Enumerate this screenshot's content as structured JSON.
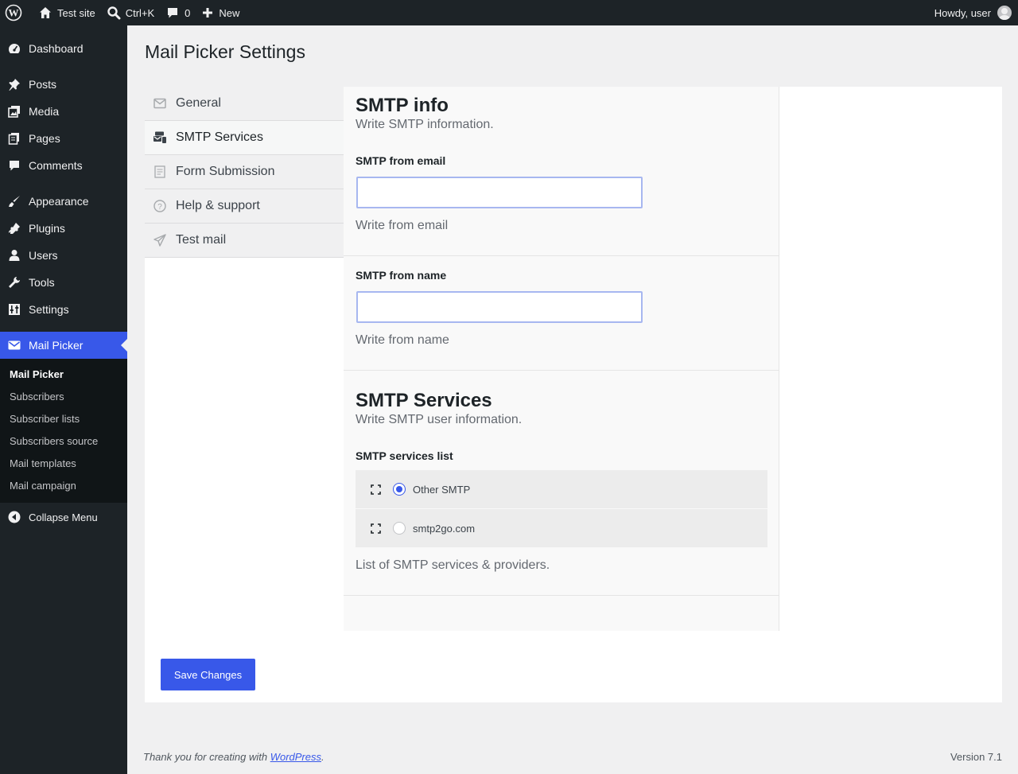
{
  "adminbar": {
    "site_name": "Test site",
    "search_shortcut": "Ctrl+K",
    "comments_count": "0",
    "new_label": "New",
    "greeting": "Howdy, user"
  },
  "sidebar": {
    "items": [
      {
        "label": "Dashboard",
        "icon": "dashboard-icon"
      },
      {
        "label": "Posts",
        "icon": "pin-icon"
      },
      {
        "label": "Media",
        "icon": "media-icon"
      },
      {
        "label": "Pages",
        "icon": "pages-icon"
      },
      {
        "label": "Comments",
        "icon": "comment-icon"
      },
      {
        "label": "Appearance",
        "icon": "brush-icon"
      },
      {
        "label": "Plugins",
        "icon": "plugin-icon"
      },
      {
        "label": "Users",
        "icon": "user-icon"
      },
      {
        "label": "Tools",
        "icon": "wrench-icon"
      },
      {
        "label": "Settings",
        "icon": "sliders-icon"
      },
      {
        "label": "Mail Picker",
        "icon": "envelope-icon"
      }
    ],
    "submenu": [
      "Mail Picker",
      "Subscribers",
      "Subscriber lists",
      "Subscribers source",
      "Mail templates",
      "Mail campaign"
    ],
    "collapse_label": "Collapse Menu",
    "accent": "#3858e9"
  },
  "page": {
    "title": "Mail Picker Settings"
  },
  "tabs": [
    {
      "label": "General",
      "icon": "envelope-outline-icon"
    },
    {
      "label": "SMTP Services",
      "icon": "mail-server-icon"
    },
    {
      "label": "Form Submission",
      "icon": "form-icon"
    },
    {
      "label": "Help & support",
      "icon": "question-icon"
    },
    {
      "label": "Test mail",
      "icon": "paper-plane-icon"
    }
  ],
  "smtp_info": {
    "title": "SMTP info",
    "description": "Write SMTP information.",
    "from_email": {
      "label": "SMTP from email",
      "value": "",
      "help": "Write from email"
    },
    "from_name": {
      "label": "SMTP from name",
      "value": "",
      "help": "Write from name"
    }
  },
  "smtp_services": {
    "title": "SMTP Services",
    "description": "Write SMTP user information.",
    "list_label": "SMTP services list",
    "options": [
      {
        "label": "Other SMTP",
        "checked": true
      },
      {
        "label": "smtp2go.com",
        "checked": false
      }
    ],
    "help": "List of SMTP services & providers."
  },
  "actions": {
    "save_label": "Save Changes"
  },
  "footer": {
    "thanks_prefix": "Thank you for creating with ",
    "thanks_link": "WordPress",
    "thanks_suffix": ".",
    "version": "Version 7.1"
  }
}
